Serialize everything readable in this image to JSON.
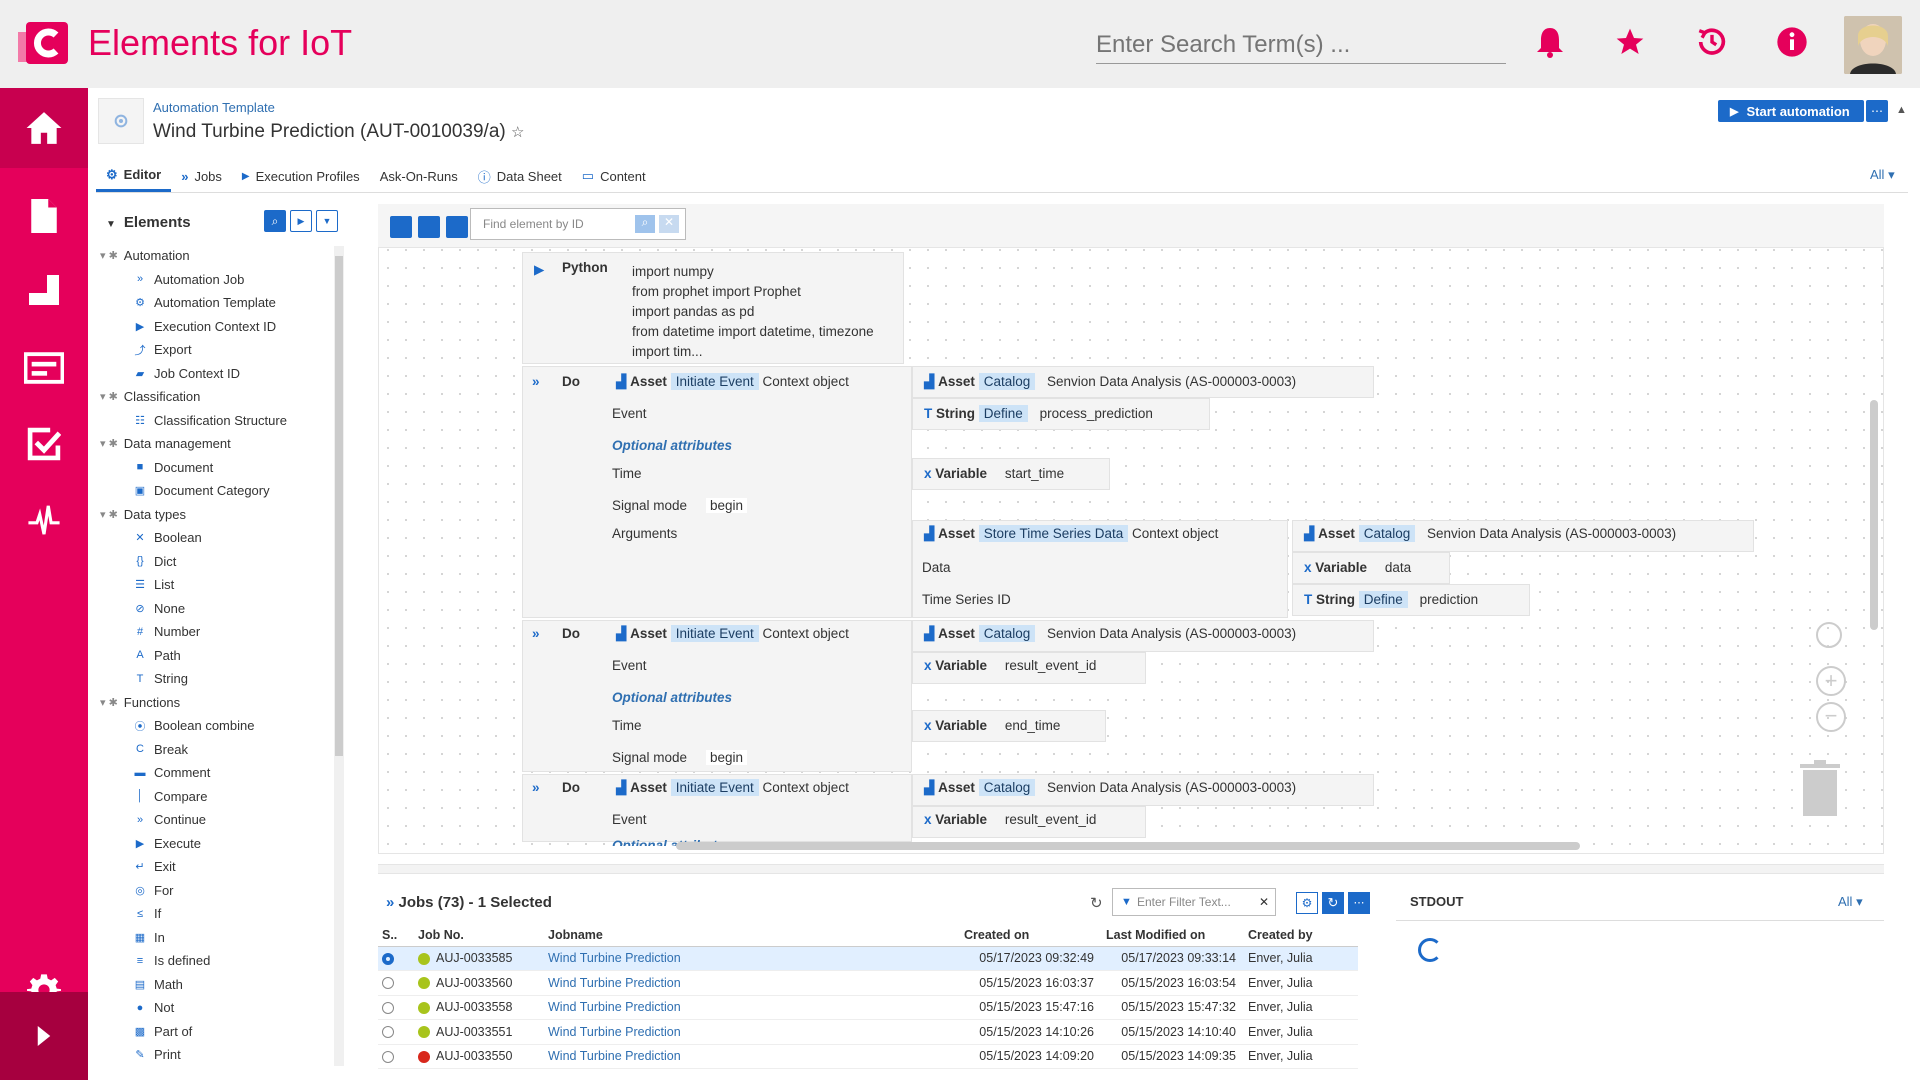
{
  "app": {
    "title": "Elements for IoT",
    "search_placeholder": "Enter Search Term(s) ..."
  },
  "header": {
    "breadcrumb": "Automation Template",
    "title": "Wind Turbine Prediction (AUT-0010039/a)",
    "start_label": "Start automation",
    "more_label": "⋯",
    "filter_all": "All"
  },
  "tabs": [
    {
      "label": "Editor"
    },
    {
      "label": "Jobs"
    },
    {
      "label": "Execution Profiles"
    },
    {
      "label": "Ask-On-Runs"
    },
    {
      "label": "Data Sheet"
    },
    {
      "label": "Content"
    }
  ],
  "elements": {
    "title": "Elements",
    "find_placeholder": "Find element by ID",
    "tree": [
      {
        "label": "Automation",
        "group": true
      },
      {
        "label": "Automation Job",
        "icon": "»"
      },
      {
        "label": "Automation Template",
        "icon": "⚙"
      },
      {
        "label": "Execution Context ID",
        "icon": "▶"
      },
      {
        "label": "Export",
        "icon": "⤴"
      },
      {
        "label": "Job Context ID",
        "icon": "▰"
      },
      {
        "label": "Classification",
        "group": true
      },
      {
        "label": "Classification Structure",
        "icon": "☷"
      },
      {
        "label": "Data management",
        "group": true
      },
      {
        "label": "Document",
        "icon": "■"
      },
      {
        "label": "Document Category",
        "icon": "▣"
      },
      {
        "label": "Data types",
        "group": true
      },
      {
        "label": "Boolean",
        "icon": "✕"
      },
      {
        "label": "Dict",
        "icon": "{}"
      },
      {
        "label": "List",
        "icon": "☰"
      },
      {
        "label": "None",
        "icon": "⊘"
      },
      {
        "label": "Number",
        "icon": "#"
      },
      {
        "label": "Path",
        "icon": "A"
      },
      {
        "label": "String",
        "icon": "T"
      },
      {
        "label": "Functions",
        "group": true
      },
      {
        "label": "Boolean combine",
        "icon": "⦿"
      },
      {
        "label": "Break",
        "icon": "C"
      },
      {
        "label": "Comment",
        "icon": "▬"
      },
      {
        "label": "Compare",
        "icon": "│"
      },
      {
        "label": "Continue",
        "icon": "»"
      },
      {
        "label": "Execute",
        "icon": "▶"
      },
      {
        "label": "Exit",
        "icon": "↵"
      },
      {
        "label": "For",
        "icon": "◎"
      },
      {
        "label": "If",
        "icon": "≤"
      },
      {
        "label": "In",
        "icon": "▦"
      },
      {
        "label": "Is defined",
        "icon": "≡"
      },
      {
        "label": "Math",
        "icon": "▤"
      },
      {
        "label": "Not",
        "icon": "●"
      },
      {
        "label": "Part of",
        "icon": "▩"
      },
      {
        "label": "Print",
        "icon": "✎"
      }
    ]
  },
  "editor": {
    "python": {
      "label": "Python",
      "lines": [
        "import numpy",
        "from prophet import Prophet",
        "import pandas as pd",
        "from datetime import datetime, timezone",
        "import tim..."
      ]
    },
    "do_label": "Do",
    "asset": "Asset",
    "initiate_event": "Initiate Event",
    "store_ts": "Store Time Series Data",
    "context_object": "Context object",
    "event": "Event",
    "optional": "Optional attributes",
    "optional_cut": "Optional attributes",
    "time": "Time",
    "signal_mode": "Signal mode",
    "begin": "begin",
    "arguments": "Arguments",
    "data": "Data",
    "ts_id": "Time Series ID",
    "catalog": "Catalog",
    "servion": "Senvion Data Analysis (AS-000003-0003)",
    "string": "String",
    "define": "Define",
    "process_prediction": "process_prediction",
    "variable": "Variable",
    "start_time": "start_time",
    "end_time": "end_time",
    "data_var": "data",
    "prediction": "prediction",
    "result_event_id": "result_event_id"
  },
  "jobs": {
    "title": "Jobs (73) - 1 Selected",
    "filter_placeholder": "Enter Filter Text...",
    "columns": [
      "S..",
      "Job No.",
      "Jobname",
      "Created on",
      "Last Modified on",
      "Created by"
    ],
    "rows": [
      {
        "job": "AUJ-0033585",
        "name": "Wind Turbine Prediction",
        "created": "05/17/2023 09:32:49",
        "modified": "05/17/2023 09:33:14",
        "by": "Enver, Julia",
        "status": "#a8c41c",
        "selected": true
      },
      {
        "job": "AUJ-0033560",
        "name": "Wind Turbine Prediction",
        "created": "05/15/2023 16:03:37",
        "modified": "05/15/2023 16:03:54",
        "by": "Enver, Julia",
        "status": "#a8c41c",
        "selected": false
      },
      {
        "job": "AUJ-0033558",
        "name": "Wind Turbine Prediction",
        "created": "05/15/2023 15:47:16",
        "modified": "05/15/2023 15:47:32",
        "by": "Enver, Julia",
        "status": "#a8c41c",
        "selected": false
      },
      {
        "job": "AUJ-0033551",
        "name": "Wind Turbine Prediction",
        "created": "05/15/2023 14:10:26",
        "modified": "05/15/2023 14:10:40",
        "by": "Enver, Julia",
        "status": "#a8c41c",
        "selected": false
      },
      {
        "job": "AUJ-0033550",
        "name": "Wind Turbine Prediction",
        "created": "05/15/2023 14:09:20",
        "modified": "05/15/2023 14:09:35",
        "by": "Enver, Julia",
        "status": "#d8281c",
        "selected": false
      }
    ]
  },
  "stdout": {
    "title": "STDOUT",
    "filter_all": "All"
  },
  "colors": {
    "brand": "#e5005b",
    "accent": "#1c6ac9"
  }
}
